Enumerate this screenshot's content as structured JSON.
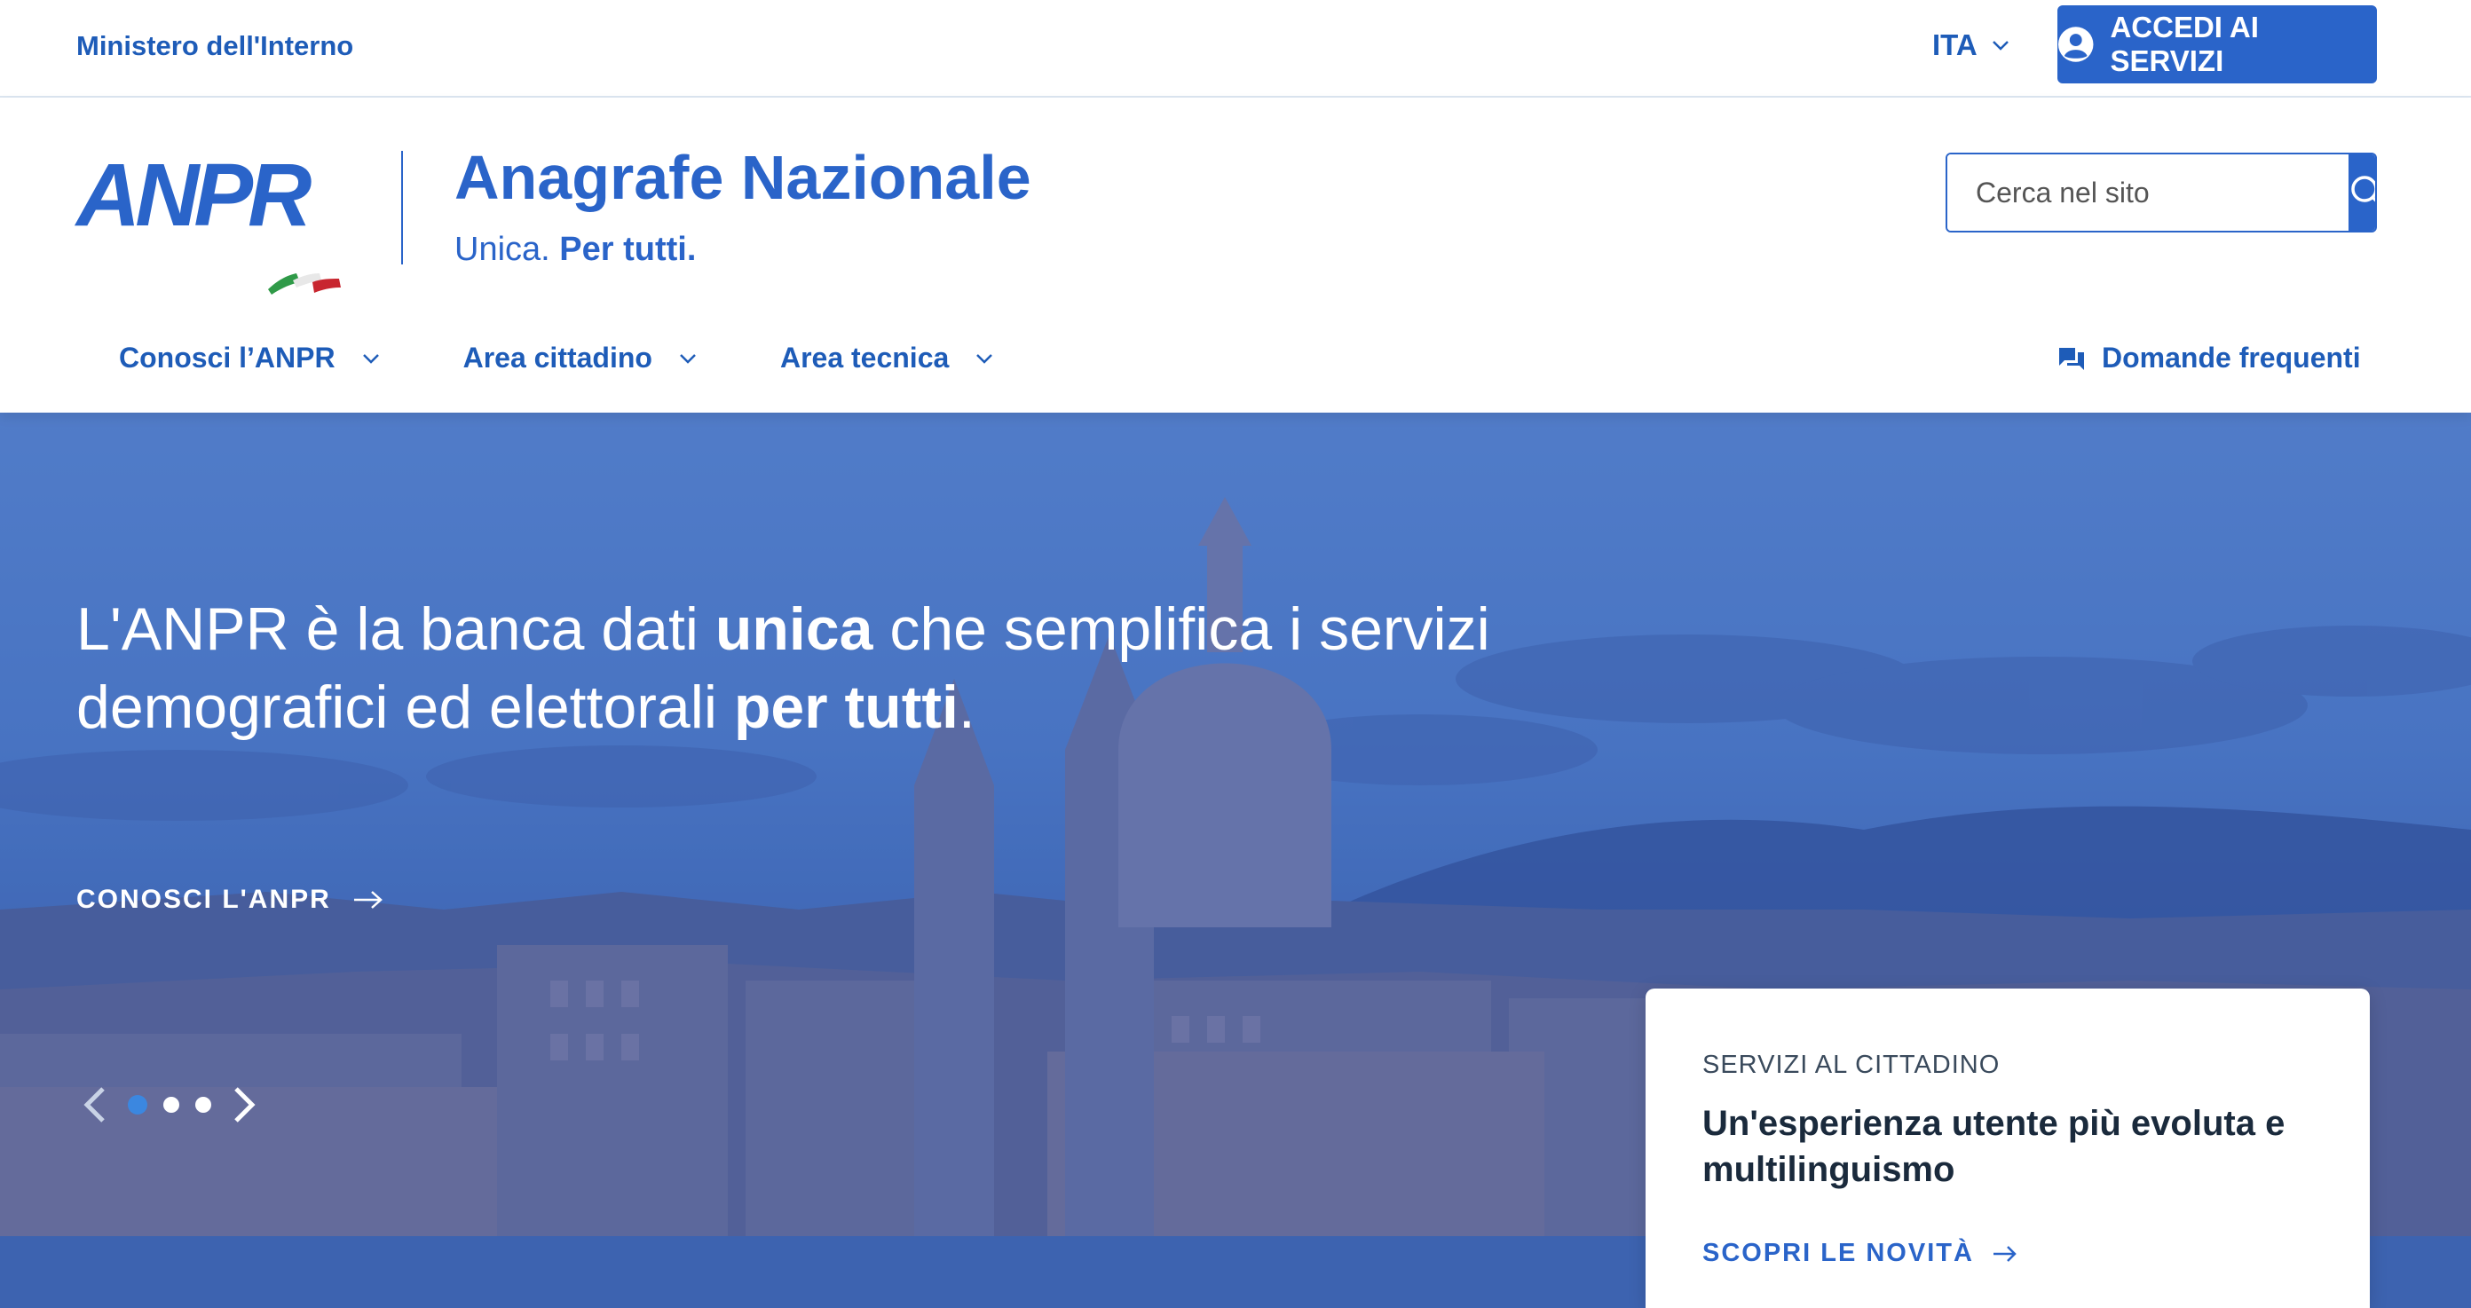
{
  "topbar": {
    "ministry": "Ministero dell'Interno",
    "language": "ITA",
    "login_label": "ACCEDI AI SERVIZI"
  },
  "header": {
    "logo_text": "ANPR",
    "title": "Anagrafe Nazionale",
    "tagline_plain": "Unica.",
    "tagline_bold": "Per tutti.",
    "search_placeholder": "Cerca nel sito"
  },
  "nav": {
    "items": [
      {
        "label": "Conosci l’ANPR"
      },
      {
        "label": "Area cittadino"
      },
      {
        "label": "Area tecnica"
      }
    ],
    "faq_label": "Domande frequenti"
  },
  "hero": {
    "title_part1": "L'ANPR è la banca dati ",
    "title_bold1": "unica",
    "title_part2": " che semplifica i servizi demografici ed elettorali ",
    "title_bold2": "per tutti",
    "title_part3": ".",
    "cta_label": "CONOSCI L'ANPR",
    "carousel": {
      "slides": 3,
      "active_index": 0
    }
  },
  "card": {
    "kicker": "SERVIZI AL CITTADINO",
    "title": "Un'esperienza utente più evoluta e multilinguismo",
    "link_label": "SCOPRI LE NOVITÀ"
  },
  "colors": {
    "brand_blue": "#2a64c9",
    "hero_blue": "#4f7cc8",
    "dot_active": "#3b87e0"
  },
  "icons": {
    "login": "user-circle-icon",
    "search": "search-icon",
    "faq": "chat-bubbles-icon",
    "chevron": "chevron-down-icon",
    "arrow": "arrow-right-icon"
  }
}
